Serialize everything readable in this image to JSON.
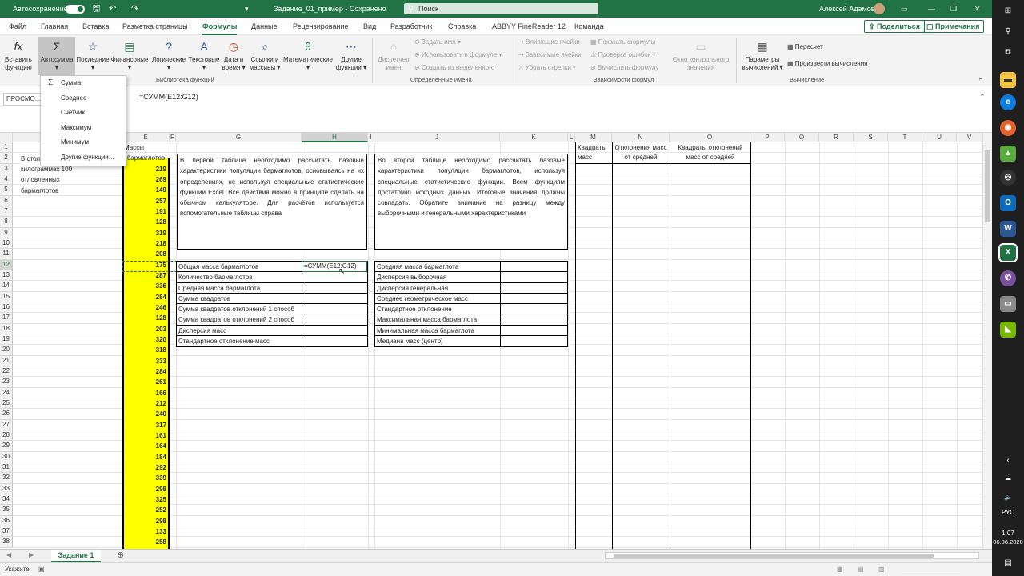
{
  "titlebar": {
    "autosave_label": "Автосохранение",
    "filename": "Задание_01_пример - Сохранено",
    "search_placeholder": "Поиск",
    "user": "Алексей Адамов"
  },
  "tabs": [
    "Файл",
    "Главная",
    "Вставка",
    "Разметка страницы",
    "Формулы",
    "Данные",
    "Рецензирование",
    "Вид",
    "Разработчик",
    "Справка",
    "ABBYY FineReader 12",
    "Команда"
  ],
  "active_tab": "Формулы",
  "share_label": "Поделиться",
  "comments_label": "Примечания",
  "ribbon": {
    "function_library": {
      "group_label": "Библиотека функций",
      "insert_function": "Вставить функцию",
      "autosum": "Автосумма",
      "recent": "Последние",
      "financial": "Финансовые",
      "logical": "Логические",
      "text": "Текстовые",
      "datetime": "Дата и время",
      "lookup": "Ссылки и массивы",
      "math": "Математические",
      "more": "Другие функции"
    },
    "defined_names": {
      "group_label": "Определенные имена",
      "manager": "Диспетчер имен",
      "define": "Задать имя",
      "use_in_formula": "Использовать в формуле",
      "create_from_selection": "Создать из выделенного"
    },
    "auditing": {
      "group_label": "Зависимости формул",
      "trace_precedents": "Влияющие ячейки",
      "trace_dependents": "Зависимые ячейки",
      "remove_arrows": "Убрать стрелки",
      "show_formulas": "Показать формулы",
      "error_checking": "Проверка ошибок",
      "evaluate": "Вычислить формулу",
      "watch_window": "Окно контрольного значения"
    },
    "calculation": {
      "group_label": "Вычисление",
      "options": "Параметры вычислений",
      "calc_now": "Пересчет",
      "calc_sheet": "Произвести вычисления"
    }
  },
  "autosum_menu": [
    "Сумма",
    "Среднее",
    "Счетчик",
    "Максимум",
    "Минимум",
    "Другие функции..."
  ],
  "formula_bar": {
    "name_box": "ПРОСМО...",
    "formula": "=СУММ(E12:G12)"
  },
  "columns": [
    "A",
    "E",
    "F",
    "G",
    "H",
    "I",
    "J",
    "K",
    "L",
    "M",
    "N",
    "O",
    "P",
    "Q",
    "R",
    "S",
    "T",
    "U",
    "V"
  ],
  "rows": [
    "1",
    "2",
    "3",
    "4",
    "5",
    "6",
    "7",
    "8",
    "9",
    "10",
    "11",
    "12",
    "13",
    "14",
    "15",
    "16",
    "17",
    "18",
    "19",
    "20",
    "21",
    "22",
    "23",
    "24",
    "25",
    "26",
    "27",
    "28",
    "29",
    "30",
    "31",
    "32",
    "33",
    "34",
    "35",
    "36",
    "37",
    "38"
  ],
  "sheet": {
    "e_header_1": "Массы",
    "e_header_2": "бармаглотов",
    "a_text_1": "В стол",
    "a_text_2": "килограммах 100",
    "a_text_3": "отловленных",
    "a_text_4": "бармаглотов",
    "masses": [
      "219",
      "269",
      "149",
      "257",
      "191",
      "128",
      "319",
      "218",
      "208",
      "175",
      "287",
      "336",
      "284",
      "246",
      "128",
      "203",
      "320",
      "318",
      "333",
      "284",
      "261",
      "166",
      "212",
      "240",
      "317",
      "161",
      "164",
      "184",
      "292",
      "339",
      "298",
      "325",
      "252",
      "298",
      "133",
      "258"
    ],
    "text_g": "В первой таблице необходимо рассчитать базовые характеристики популяции бармаглотов, основываясь на их определениях, не используя специальные статистические функции Excel. Все действия можно в принципе сделать на обычном калькуляторе. Для расчётов используется вспомогательные таблицы справа",
    "text_j": "Во второй таблице необходимо рассчитать базовые характеристики популяции бармаглотов, используя специальные статистические функции. Всем функциям достаточно исходных данных. Итоговые значения должны совпадать. Обратите внимание на разницу между выборочными и генеральными характеристиками",
    "table1": [
      "Общая масса бармаглотов",
      "Количество бармаглотов",
      "Средняя масса бармаглота",
      "Сумма квадратов",
      "Сумма квадратов отклонений 1 способ",
      "Сумма квадратов отклонений 2 способ",
      "Дисперсия масс",
      "Стандартное отклонение масс"
    ],
    "editing_cell": "=СУММ(E12:G12)",
    "table2": [
      "Средняя масса бармаглота",
      "Дисперсия выборочная",
      "Дисперсия генеральная",
      "Среднее геометрическое масс",
      "Стандартное отклонение",
      "Максимальная масса бармаглота",
      "Минимальная масса бармаглота",
      "Медиана масс (центр)"
    ],
    "m_header": "Квадраты масс",
    "n_header": "Отклонения масс от средней",
    "o_header": "Квадраты отклонений масс от средней"
  },
  "sheet_tab": "Задание 1",
  "status": "Укажите",
  "taskbar": {
    "lang": "РУС",
    "time": "1:07",
    "date": "06.06.2020"
  }
}
